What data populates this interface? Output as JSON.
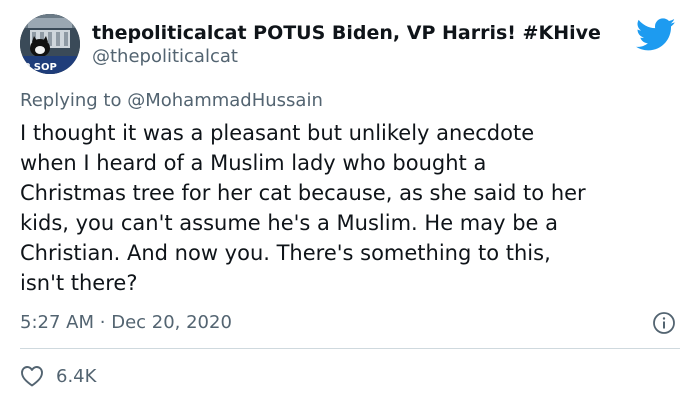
{
  "author": {
    "display_name": "thepoliticalcat POTUS Biden, VP Harris! #KHive",
    "handle": "@thepoliticalcat",
    "avatar_text": "P SOP"
  },
  "reply": {
    "prefix": "Replying to",
    "mention": "@MohammadHussain"
  },
  "tweet": {
    "text": "I thought it was a pleasant but unlikely anecdote\nwhen I heard of a Muslim lady who bought a\nChristmas tree for her cat because, as she said to her\nkids, you can't assume he's a Muslim. He may be a\nChristian. And now you. There's something to this,\nisn't there?",
    "time": "5:27 AM",
    "separator": "·",
    "date": "Dec 20, 2020"
  },
  "engagement": {
    "likes": "6.4K"
  },
  "colors": {
    "twitter_blue": "#1d9bf0",
    "secondary_text": "#536471",
    "divider": "#cfd9de"
  },
  "icons": {
    "brand": "twitter-bird-icon",
    "info": "info-icon",
    "like": "heart-icon"
  }
}
